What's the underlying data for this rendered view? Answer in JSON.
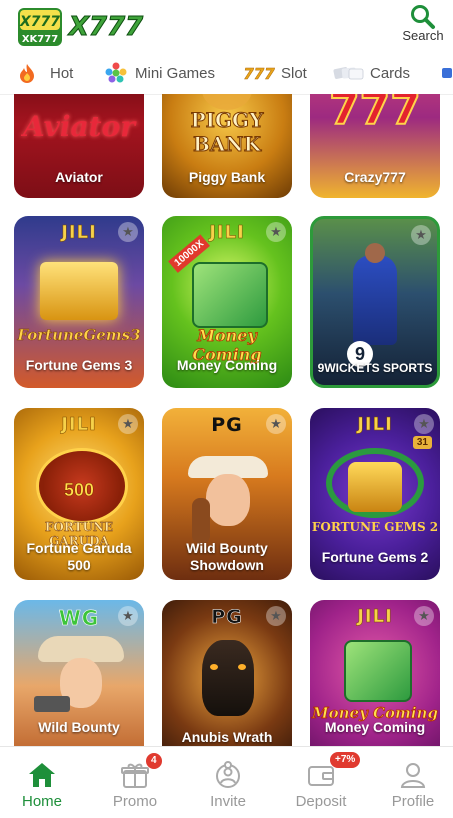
{
  "header": {
    "logo_small_text": "XK777",
    "logo_text": "X777",
    "search_label": "Search"
  },
  "categories": [
    {
      "label": "Hot",
      "icon": "fire-icon"
    },
    {
      "label": "Mini Games",
      "icon": "dots-icon"
    },
    {
      "label": "Slot",
      "icon": "slot-777-icon"
    },
    {
      "label": "Cards",
      "icon": "cards-icon"
    }
  ],
  "games": [
    {
      "title": "Aviator",
      "provider": "",
      "art_text": "Aviator"
    },
    {
      "title": "Piggy Bank",
      "provider": "",
      "art_text": "PIGGY BANK"
    },
    {
      "title": "Crazy777",
      "provider": "",
      "art_text": "777"
    },
    {
      "title": "Fortune Gems 3",
      "provider": "JILI",
      "art_text": "FortuneGems3"
    },
    {
      "title": "Money Coming",
      "provider": "JILI",
      "art_text": "Money Coming",
      "corner": "10000X"
    },
    {
      "title": "9WICKETS SPORTS",
      "provider": "",
      "art_text": "9"
    },
    {
      "title": "Fortune Garuda 500",
      "provider": "JILI",
      "art_text": "FORTUNE GARUDA",
      "corner": "500"
    },
    {
      "title": "Wild Bounty Showdown",
      "provider": "PG",
      "art_text": ""
    },
    {
      "title": "Fortune Gems 2",
      "provider": "JILI",
      "art_text": "FORTUNE GEMS 2",
      "corner": "31"
    },
    {
      "title": "Wild Bounty",
      "provider": "WG",
      "art_text": ""
    },
    {
      "title": "Anubis Wrath",
      "provider": "PG",
      "art_text": ""
    },
    {
      "title": "Money Coming",
      "provider": "JILI",
      "art_text": "Money Coming"
    }
  ],
  "tabs": [
    {
      "label": "Home",
      "icon": "home-icon",
      "active": true
    },
    {
      "label": "Promo",
      "icon": "gift-icon",
      "badge": "4"
    },
    {
      "label": "Invite",
      "icon": "invite-icon"
    },
    {
      "label": "Deposit",
      "icon": "wallet-icon",
      "badge": "+7%"
    },
    {
      "label": "Profile",
      "icon": "profile-icon"
    }
  ],
  "colors": {
    "accent": "#1e8f3a",
    "badge": "#e03a2f"
  }
}
